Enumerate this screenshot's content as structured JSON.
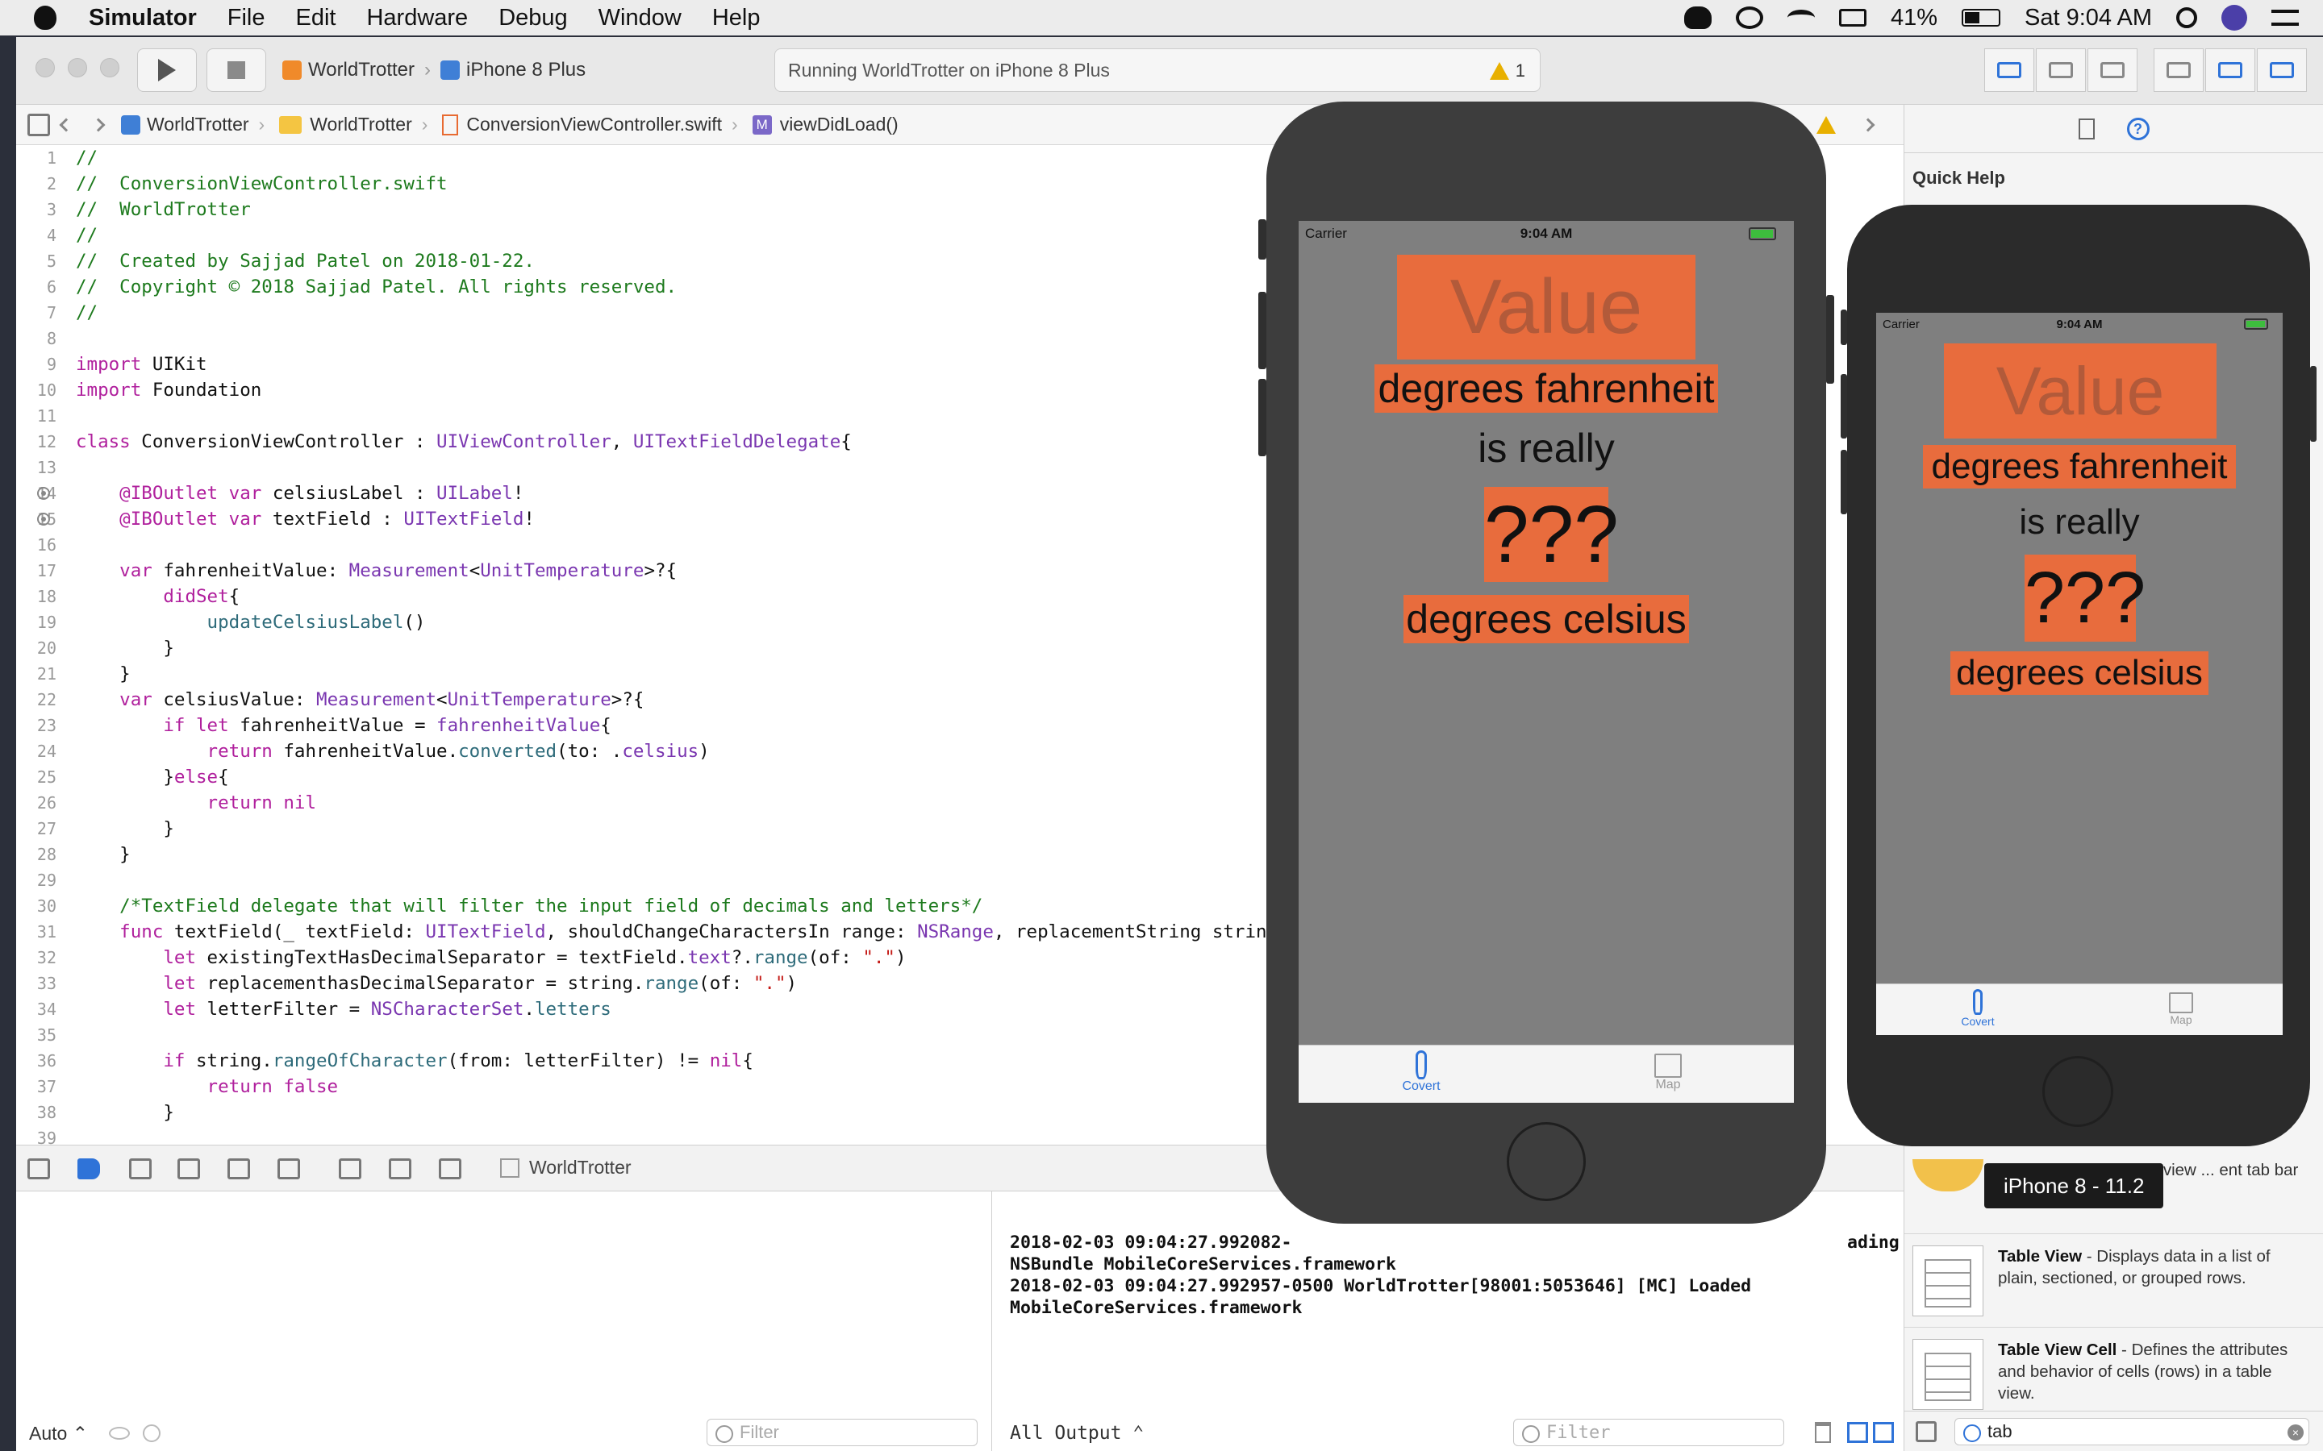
{
  "menubar": {
    "app_name": "Simulator",
    "items": [
      "File",
      "Edit",
      "Hardware",
      "Debug",
      "Window",
      "Help"
    ],
    "battery_percent": "41%",
    "clock": "Sat 9:04 AM"
  },
  "toolbar": {
    "scheme_target": "WorldTrotter",
    "scheme_device": "iPhone 8 Plus",
    "activity_text": "Running WorldTrotter on iPhone 8 Plus",
    "warning_count": "1"
  },
  "jumpbar": {
    "crumbs": [
      "WorldTrotter",
      "WorldTrotter",
      "ConversionViewController.swift",
      "viewDidLoad()"
    ]
  },
  "editor": {
    "lines": [
      {
        "n": "1",
        "t": [
          [
            "c-com",
            "//"
          ]
        ]
      },
      {
        "n": "2",
        "t": [
          [
            "c-com",
            "//  ConversionViewController.swift"
          ]
        ]
      },
      {
        "n": "3",
        "t": [
          [
            "c-com",
            "//  WorldTrotter"
          ]
        ]
      },
      {
        "n": "4",
        "t": [
          [
            "c-com",
            "//"
          ]
        ]
      },
      {
        "n": "5",
        "t": [
          [
            "c-com",
            "//  Created by Sajjad Patel on 2018-01-22."
          ]
        ]
      },
      {
        "n": "6",
        "t": [
          [
            "c-com",
            "//  Copyright © 2018 Sajjad Patel. All rights reserved."
          ]
        ]
      },
      {
        "n": "7",
        "t": [
          [
            "c-com",
            "//"
          ]
        ]
      },
      {
        "n": "8",
        "t": []
      },
      {
        "n": "9",
        "t": [
          [
            "c-kw",
            "import"
          ],
          [
            "c-pl",
            " UIKit"
          ]
        ]
      },
      {
        "n": "10",
        "t": [
          [
            "c-kw",
            "import"
          ],
          [
            "c-pl",
            " Foundation"
          ]
        ]
      },
      {
        "n": "11",
        "t": []
      },
      {
        "n": "12",
        "t": [
          [
            "c-kw",
            "class"
          ],
          [
            "c-pl",
            " ConversionViewController : "
          ],
          [
            "c-ty",
            "UIViewController"
          ],
          [
            "c-pl",
            ", "
          ],
          [
            "c-ty",
            "UITextFieldDelegate"
          ],
          [
            "c-pl",
            "{"
          ]
        ]
      },
      {
        "n": "13",
        "t": []
      },
      {
        "n": "14",
        "bp": true,
        "t": [
          [
            "c-kw",
            "    @IBOutlet var"
          ],
          [
            "c-pl",
            " celsiusLabel : "
          ],
          [
            "c-ty",
            "UILabel"
          ],
          [
            "c-pl",
            "!"
          ]
        ]
      },
      {
        "n": "15",
        "bp": true,
        "t": [
          [
            "c-kw",
            "    @IBOutlet var"
          ],
          [
            "c-pl",
            " textField : "
          ],
          [
            "c-ty",
            "UITextField"
          ],
          [
            "c-pl",
            "!"
          ]
        ]
      },
      {
        "n": "16",
        "t": []
      },
      {
        "n": "17",
        "t": [
          [
            "c-kw",
            "    var"
          ],
          [
            "c-pl",
            " fahrenheitValue: "
          ],
          [
            "c-ty",
            "Measurement"
          ],
          [
            "c-pl",
            "<"
          ],
          [
            "c-ty",
            "UnitTemperature"
          ],
          [
            "c-pl",
            ">?{"
          ]
        ]
      },
      {
        "n": "18",
        "t": [
          [
            "c-kw",
            "        didSet"
          ],
          [
            "c-pl",
            "{"
          ]
        ]
      },
      {
        "n": "19",
        "t": [
          [
            "c-fn",
            "            updateCelsiusLabel"
          ],
          [
            "c-pl",
            "()"
          ]
        ]
      },
      {
        "n": "20",
        "t": [
          [
            "c-pl",
            "        }"
          ]
        ]
      },
      {
        "n": "21",
        "t": [
          [
            "c-pl",
            "    }"
          ]
        ]
      },
      {
        "n": "22",
        "t": [
          [
            "c-kw",
            "    var"
          ],
          [
            "c-pl",
            " celsiusValue: "
          ],
          [
            "c-ty",
            "Measurement"
          ],
          [
            "c-pl",
            "<"
          ],
          [
            "c-ty",
            "UnitTemperature"
          ],
          [
            "c-pl",
            ">?{"
          ]
        ]
      },
      {
        "n": "23",
        "t": [
          [
            "c-kw",
            "        if let"
          ],
          [
            "c-pl",
            " fahrenheitValue = "
          ],
          [
            "c-ty",
            "fahrenheitValue"
          ],
          [
            "c-pl",
            "{"
          ]
        ]
      },
      {
        "n": "24",
        "t": [
          [
            "c-kw",
            "            return"
          ],
          [
            "c-pl",
            " fahrenheitValue."
          ],
          [
            "c-fn",
            "converted"
          ],
          [
            "c-pl",
            "(to: ."
          ],
          [
            "c-ty",
            "celsius"
          ],
          [
            "c-pl",
            ")"
          ]
        ]
      },
      {
        "n": "25",
        "t": [
          [
            "c-pl",
            "        }"
          ],
          [
            "c-kw",
            "else"
          ],
          [
            "c-pl",
            "{"
          ]
        ]
      },
      {
        "n": "26",
        "t": [
          [
            "c-kw",
            "            return nil"
          ]
        ]
      },
      {
        "n": "27",
        "t": [
          [
            "c-pl",
            "        }"
          ]
        ]
      },
      {
        "n": "28",
        "t": [
          [
            "c-pl",
            "    }"
          ]
        ]
      },
      {
        "n": "29",
        "t": []
      },
      {
        "n": "30",
        "t": [
          [
            "c-com",
            "    /*TextField delegate that will filter the input field of decimals and letters*/"
          ]
        ]
      },
      {
        "n": "31",
        "t": [
          [
            "c-kw",
            "    func"
          ],
          [
            "c-pl",
            " textField(_ textField: "
          ],
          [
            "c-ty",
            "UITextField"
          ],
          [
            "c-pl",
            ", shouldChangeCharactersIn range: "
          ],
          [
            "c-ty",
            "NSRange"
          ],
          [
            "c-pl",
            ", replacementString strin"
          ]
        ]
      },
      {
        "n": "32",
        "t": [
          [
            "c-kw",
            "        let"
          ],
          [
            "c-pl",
            " existingTextHasDecimalSeparator = textField."
          ],
          [
            "c-ty",
            "text"
          ],
          [
            "c-pl",
            "?."
          ],
          [
            "c-fn",
            "range"
          ],
          [
            "c-pl",
            "(of: "
          ],
          [
            "c-str",
            "\".\""
          ],
          [
            "c-pl",
            ")"
          ]
        ]
      },
      {
        "n": "33",
        "t": [
          [
            "c-kw",
            "        let"
          ],
          [
            "c-pl",
            " replacementhasDecimalSeparator = string."
          ],
          [
            "c-fn",
            "range"
          ],
          [
            "c-pl",
            "(of: "
          ],
          [
            "c-str",
            "\".\""
          ],
          [
            "c-pl",
            ")"
          ]
        ]
      },
      {
        "n": "34",
        "t": [
          [
            "c-kw",
            "        let"
          ],
          [
            "c-pl",
            " letterFilter = "
          ],
          [
            "c-ty",
            "NSCharacterSet"
          ],
          [
            "c-pl",
            "."
          ],
          [
            "c-fn",
            "letters"
          ]
        ]
      },
      {
        "n": "35",
        "t": []
      },
      {
        "n": "36",
        "t": [
          [
            "c-kw",
            "        if"
          ],
          [
            "c-pl",
            " string."
          ],
          [
            "c-fn",
            "rangeOfCharacter"
          ],
          [
            "c-pl",
            "(from: letterFilter) != "
          ],
          [
            "c-kw",
            "nil"
          ],
          [
            "c-pl",
            "{"
          ]
        ]
      },
      {
        "n": "37",
        "t": [
          [
            "c-kw",
            "            return false"
          ]
        ]
      },
      {
        "n": "38",
        "t": [
          [
            "c-pl",
            "        }"
          ]
        ]
      },
      {
        "n": "39",
        "t": []
      }
    ]
  },
  "debugbar": {
    "target": "WorldTrotter"
  },
  "variables": {
    "mode": "Auto ⌃",
    "filter_placeholder": "Filter"
  },
  "console": {
    "text": "2018-02-03 09:04:27.992082-\nNSBundle MobileCoreServices.framework\n2018-02-03 09:04:27.992957-0500 WorldTrotter[98001:5053646] [MC] Loaded\nMobileCoreServices.framework",
    "tail_fragment": "ading",
    "output_mode": "All Output ⌃",
    "filter_placeholder": "Filter"
  },
  "inspector": {
    "title": "Quick Help",
    "partial_item": "that manages a set of view ... ent tab bar ite...",
    "library": [
      {
        "name": "Table View",
        "desc": " - Displays data in a list of plain, sectioned, or grouped rows."
      },
      {
        "name": "Table View Cell",
        "desc": " - Defines the attributes and behavior of cells (rows) in a table view."
      }
    ],
    "search_value": "tab"
  },
  "tooltip": "iPhone 8 - 11.2",
  "app": {
    "carrier": "Carrier",
    "time": "9:04 AM",
    "value_placeholder": "Value",
    "fahrenheit_label": "degrees fahrenheit",
    "is_really": "is really",
    "result": "???",
    "celsius_label": "degrees celsius",
    "tab_convert": "Covert",
    "tab_map": "Map"
  },
  "colors": {
    "accent_orange": "#e86c3d",
    "screen_gray": "#7f7f7f",
    "tint_blue": "#2f73d8"
  }
}
